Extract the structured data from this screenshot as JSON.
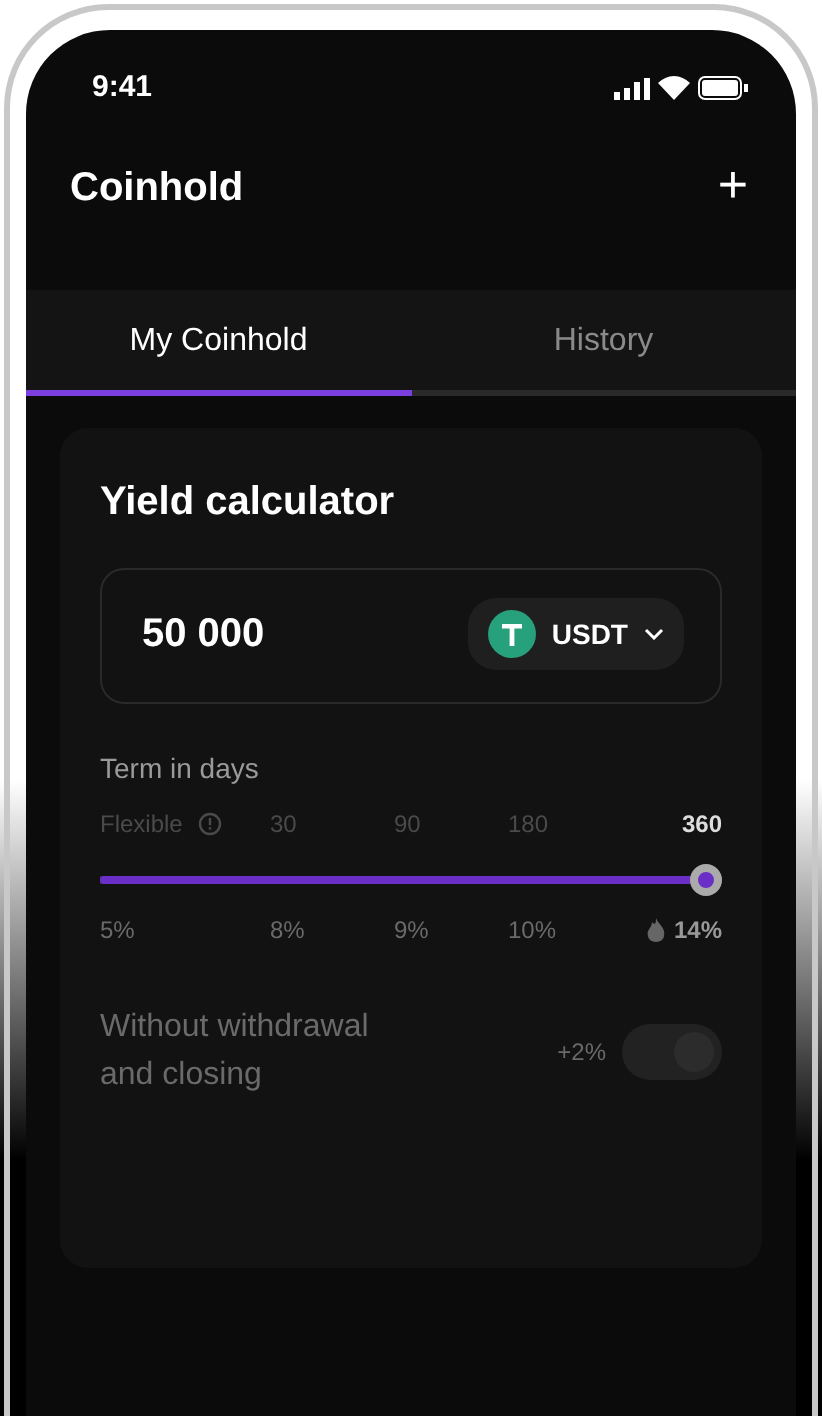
{
  "status_bar": {
    "time": "9:41"
  },
  "header": {
    "title": "Coinhold",
    "add_icon": "+"
  },
  "tabs": [
    {
      "label": "My Coinhold",
      "selected": true
    },
    {
      "label": "History",
      "selected": false
    }
  ],
  "calculator": {
    "title": "Yield calculator",
    "amount": "50 000",
    "currency": "USDT",
    "term_label": "Term in days",
    "terms": [
      {
        "label": "Flexible",
        "selected": false,
        "info": true
      },
      {
        "label": "30",
        "selected": false
      },
      {
        "label": "90",
        "selected": false
      },
      {
        "label": "180",
        "selected": false
      },
      {
        "label": "360",
        "selected": true
      }
    ],
    "slider": {
      "level": 1
    },
    "rates": [
      {
        "label": "5%",
        "hot": false
      },
      {
        "label": "8%",
        "hot": false
      },
      {
        "label": "9%",
        "hot": false
      },
      {
        "label": "10%",
        "hot": false
      },
      {
        "label": "14%",
        "hot": true
      }
    ],
    "option": {
      "label": "Without withdrawal and closing",
      "bonus": "+2%",
      "on": true
    }
  }
}
